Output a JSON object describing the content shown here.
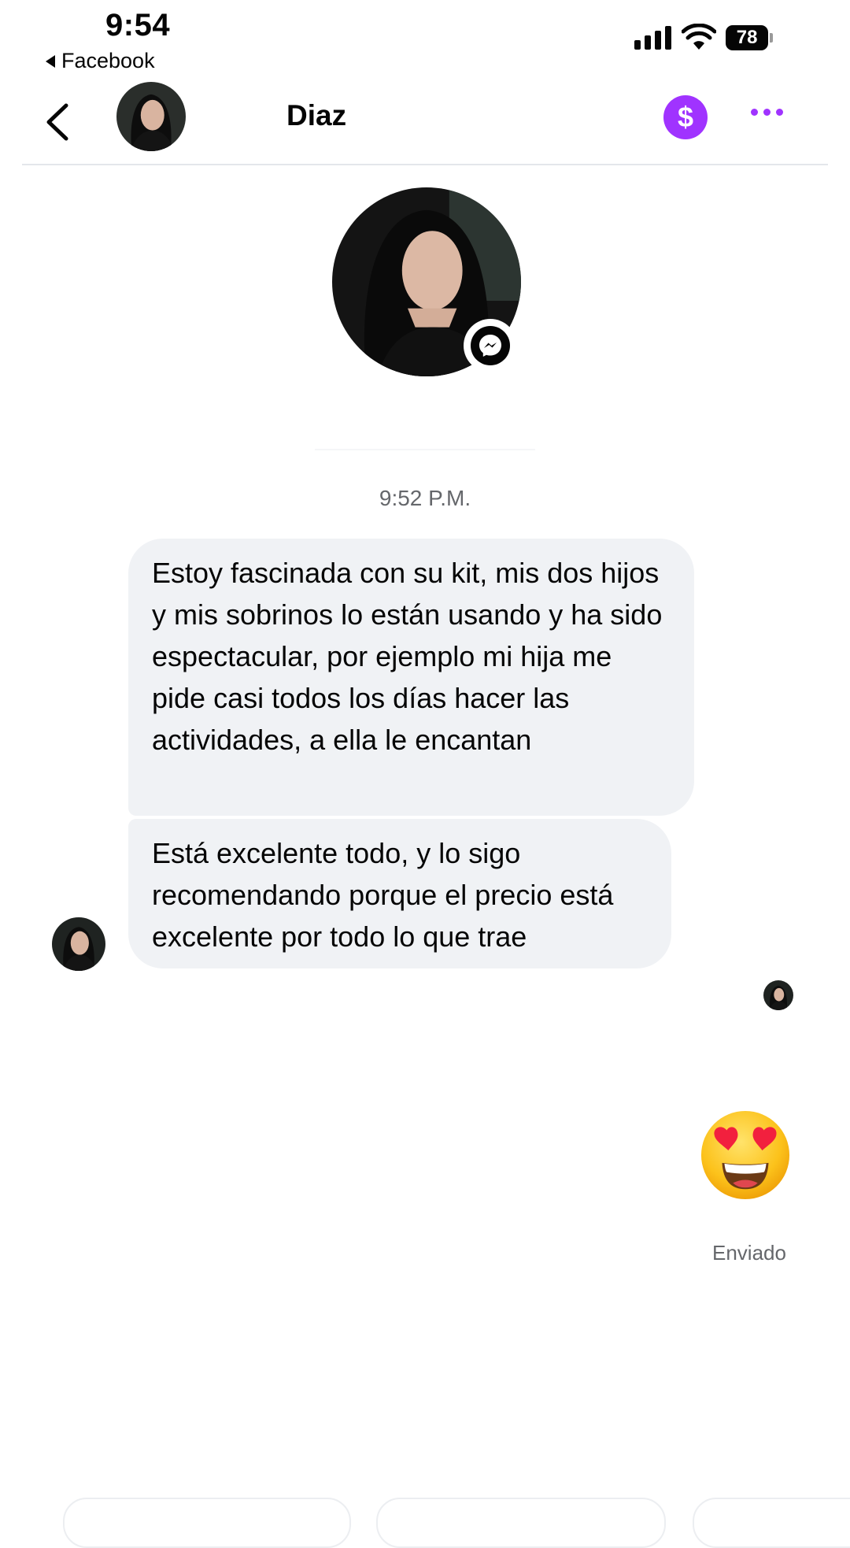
{
  "status_bar": {
    "time": "9:54",
    "back_to_app": "Facebook",
    "battery": "78",
    "icons": [
      "cellular-signal-icon",
      "wifi-icon",
      "battery-icon"
    ]
  },
  "header": {
    "contact_name": "Diaz",
    "icons": [
      "back-chevron-icon",
      "dollar-icon",
      "more-dots-icon"
    ]
  },
  "conversation": {
    "timestamp": "9:52 P.M.",
    "messages": [
      {
        "from": "contact",
        "text": "Estoy fascinada con su kit, mis dos hijos y mis sobrinos lo están usando y ha sido espectacular, por ejemplo mi hija me pide casi todos los días hacer las actividades, a ella le encantan"
      },
      {
        "from": "contact",
        "text": "Está excelente todo, y lo sigo recomendando porque el precio está excelente por todo lo que trae"
      },
      {
        "from": "me",
        "emoji": "heart-eyes-emoji"
      }
    ],
    "sent_status": "Enviado"
  },
  "colors": {
    "accent": "#a033ff",
    "bubble_bg": "#f0f2f5",
    "secondary_text": "#65676b"
  }
}
